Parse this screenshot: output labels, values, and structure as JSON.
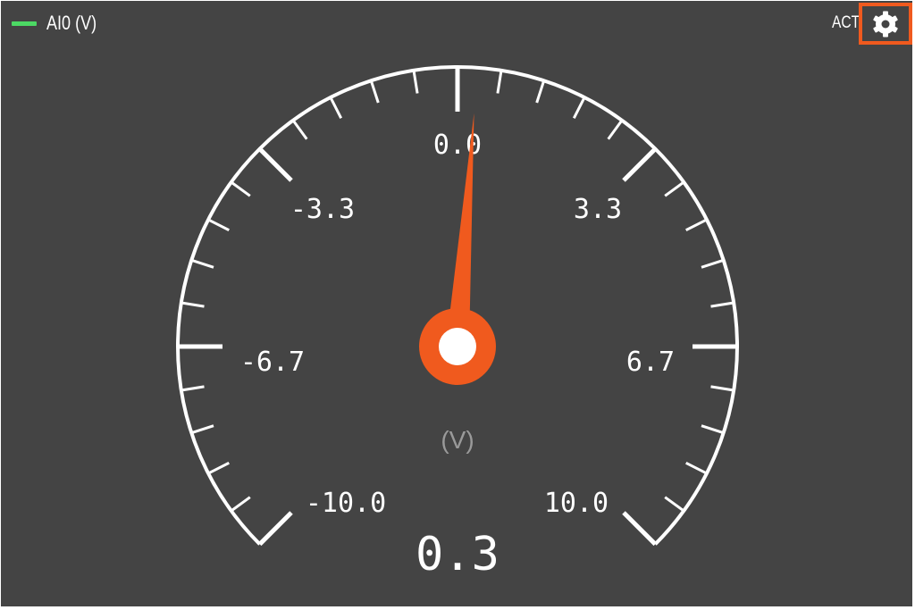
{
  "header": {
    "channel_label": "AI0 (V)",
    "status_label": "ACT"
  },
  "gauge": {
    "min": -10.0,
    "max": 10.0,
    "value": 0.3,
    "value_label": "0.3",
    "units": "(V)",
    "tick_labels": [
      "-10.0",
      "-6.7",
      "-3.3",
      "0.0",
      "3.3",
      "6.7",
      "10.0"
    ]
  },
  "colors": {
    "background": "#444444",
    "needle": "#f05a1e",
    "legend_swatch": "#4cd964",
    "highlight_border": "#f05a1e"
  },
  "icons": {
    "settings": "gear-icon"
  }
}
